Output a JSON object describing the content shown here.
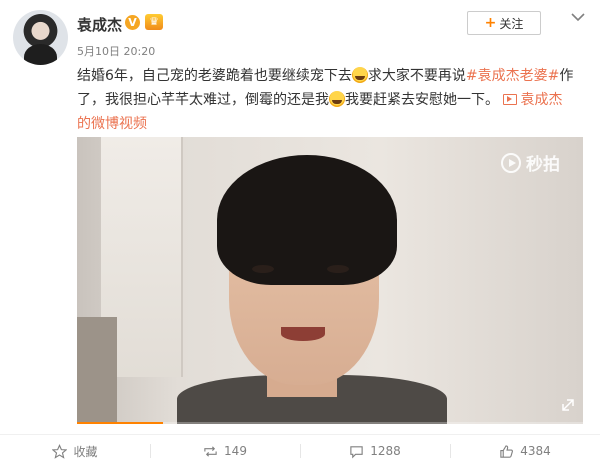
{
  "user": {
    "name": "袁成杰",
    "timestamp": "5月10日 20:20"
  },
  "header": {
    "follow_label": "关注"
  },
  "post": {
    "line1": {
      "text": "结婚6年，自己宠的老婆跪着也要继续宠下去",
      "after_emoji": "求大家不要再说",
      "hashtag": "#袁成杰老婆#",
      "tail": "作"
    },
    "line2": {
      "text": "了，我很担心芊芊太难过，倒霉的还是我",
      "after_emoji": "我要赶紧去安慰她一下。",
      "video_link": "袁成杰"
    },
    "line3": {
      "text": "的微博视频"
    }
  },
  "video": {
    "watermark": "秒拍",
    "progress": 0.17
  },
  "actions": {
    "favorite_label": "收藏",
    "repost_count": "149",
    "comment_count": "1288",
    "like_count": "4384"
  },
  "colors": {
    "accent": "#eb7350",
    "orange": "#ff8200"
  }
}
